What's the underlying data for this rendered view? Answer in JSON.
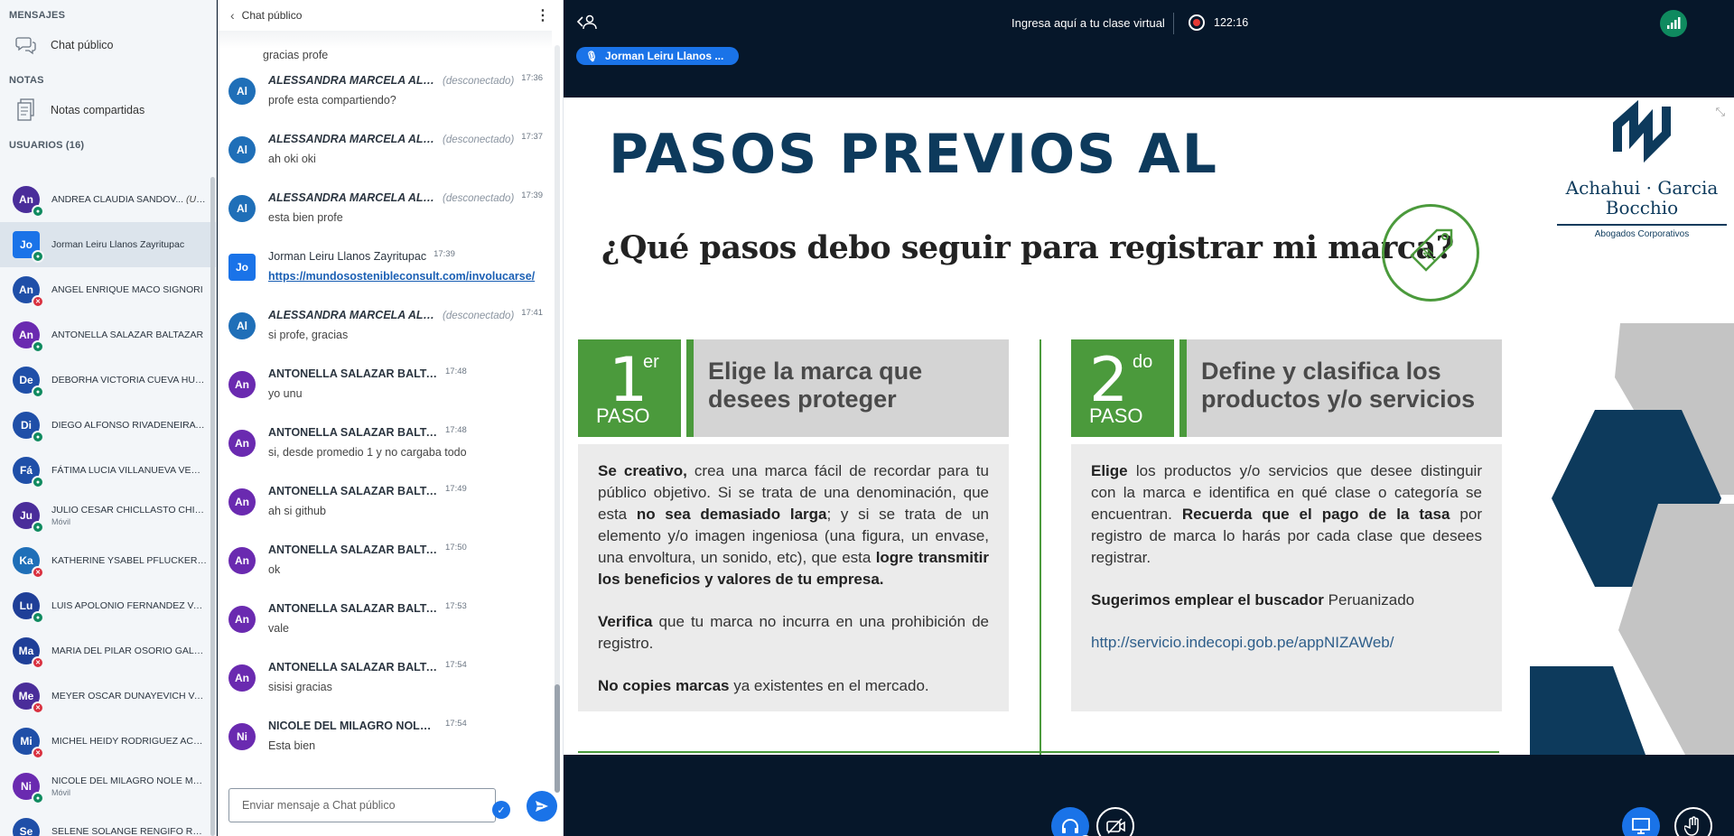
{
  "sidebar": {
    "messages_title": "MENSAJES",
    "public_chat": "Chat público",
    "notes_title": "NOTAS",
    "shared_notes": "Notas compartidas",
    "users_title": "USUARIOS (16)",
    "users": [
      {
        "initials": "An",
        "name": "ANDREA CLAUDIA SANDOV...",
        "you": "(Usted)",
        "sub": "",
        "color": "#4a2d9a",
        "status": "on"
      },
      {
        "initials": "Jo",
        "name": "Jorman Leiru Llanos Zayritupac",
        "sub": "",
        "color": "#1a73e8",
        "status": "on",
        "presenter": true
      },
      {
        "initials": "An",
        "name": "ANGEL ENRIQUE MACO SIGNORI",
        "sub": "",
        "color": "#1f4fa8",
        "status": "off"
      },
      {
        "initials": "An",
        "name": "ANTONELLA SALAZAR BALTAZAR",
        "sub": "",
        "color": "#6a2ab0",
        "status": "on"
      },
      {
        "initials": "De",
        "name": "DEBORHA VICTORIA CUEVA HUAPA...",
        "sub": "",
        "color": "#1f4fa8",
        "status": "on"
      },
      {
        "initials": "Di",
        "name": "DIEGO ALFONSO RIVADENEIRA TU...",
        "sub": "",
        "color": "#1f4fa8",
        "status": "on"
      },
      {
        "initials": "Fá",
        "name": "FÁTIMA LUCIA VILLANUEVA VENEG...",
        "sub": "",
        "color": "#1f4fa8",
        "status": "on"
      },
      {
        "initials": "Ju",
        "name": "JULIO CESAR CHICLLASTO CHIPANA",
        "sub": "Móvil",
        "color": "#4a2d9a",
        "status": "on"
      },
      {
        "initials": "Ka",
        "name": "KATHERINE YSABEL PFLUCKER GU...",
        "sub": "",
        "color": "#1f6fb8",
        "status": "off"
      },
      {
        "initials": "Lu",
        "name": "LUIS APOLONIO FERNANDEZ VARG...",
        "sub": "",
        "color": "#1f3f98",
        "status": "on"
      },
      {
        "initials": "Ma",
        "name": "MARIA DEL PILAR OSORIO GALARZA",
        "sub": "",
        "color": "#1f3f98",
        "status": "off"
      },
      {
        "initials": "Me",
        "name": "MEYER OSCAR DUNAYEVICH VARGAS",
        "sub": "",
        "color": "#4a2d9a",
        "status": "off"
      },
      {
        "initials": "Mi",
        "name": "MICHEL HEIDY RODRIGUEZ ACCOS...",
        "sub": "",
        "color": "#1f4fa8",
        "status": "off"
      },
      {
        "initials": "Ni",
        "name": "NICOLE DEL MILAGRO NOLE MEDINA",
        "sub": "Móvil",
        "color": "#6a2ab0",
        "status": "on"
      },
      {
        "initials": "Se",
        "name": "SELENE SOLANGE RENGIFO RAMIR...",
        "sub": "",
        "color": "#1f4fa8",
        "status": "on"
      }
    ]
  },
  "chat": {
    "title": "Chat público",
    "first_text": "gracias profe",
    "messages": [
      {
        "initials": "Al",
        "name": "ALESSANDRA MARCELA ALEJO...",
        "status": "(desconectado)",
        "time": "17:36",
        "text": "profe esta compartiendo?",
        "color": "#1f6fb8",
        "style": "italic"
      },
      {
        "initials": "Al",
        "name": "ALESSANDRA MARCELA ALEJO...",
        "status": "(desconectado)",
        "time": "17:37",
        "text": "ah oki oki",
        "color": "#1f6fb8",
        "style": "italic"
      },
      {
        "initials": "Al",
        "name": "ALESSANDRA MARCELA ALEJO...",
        "status": "(desconectado)",
        "time": "17:39",
        "text": "esta bien profe",
        "color": "#1f6fb8",
        "style": "italic"
      },
      {
        "initials": "Jo",
        "name": "Jorman Leiru Llanos Zayritupac",
        "status": "",
        "time": "17:39",
        "text": "https://mundosostenibleconsult.com/involucarse/",
        "color": "#1a73e8",
        "style": "plain",
        "link": true
      },
      {
        "initials": "Al",
        "name": "ALESSANDRA MARCELA ALEJO...",
        "status": "(desconectado)",
        "time": "17:41",
        "text": "si profe, gracias",
        "color": "#1f6fb8",
        "style": "italic"
      },
      {
        "initials": "An",
        "name": "ANTONELLA SALAZAR BALTAZAR",
        "status": "",
        "time": "17:48",
        "text": "yo unu",
        "color": "#6a2ab0",
        "style": "bold"
      },
      {
        "initials": "An",
        "name": "ANTONELLA SALAZAR BALTAZAR",
        "status": "",
        "time": "17:48",
        "text": "si, desde promedio 1 y no cargaba todo",
        "color": "#6a2ab0",
        "style": "bold"
      },
      {
        "initials": "An",
        "name": "ANTONELLA SALAZAR BALTAZAR",
        "status": "",
        "time": "17:49",
        "text": "ah si github",
        "color": "#6a2ab0",
        "style": "bold"
      },
      {
        "initials": "An",
        "name": "ANTONELLA SALAZAR BALTAZAR",
        "status": "",
        "time": "17:50",
        "text": "ok",
        "color": "#6a2ab0",
        "style": "bold"
      },
      {
        "initials": "An",
        "name": "ANTONELLA SALAZAR BALTAZAR",
        "status": "",
        "time": "17:53",
        "text": "vale",
        "color": "#6a2ab0",
        "style": "bold"
      },
      {
        "initials": "An",
        "name": "ANTONELLA SALAZAR BALTAZAR",
        "status": "",
        "time": "17:54",
        "text": "sisisi gracias",
        "color": "#6a2ab0",
        "style": "bold"
      },
      {
        "initials": "Ni",
        "name": "NICOLE DEL MILAGRO NOLE MEDINA",
        "status": "",
        "time": "17:54",
        "text": "Esta bien",
        "color": "#6a2ab0",
        "style": "bold"
      }
    ],
    "input_placeholder": "Enviar mensaje a Chat público"
  },
  "meeting": {
    "title": "Ingresa aquí a tu clase virtual",
    "timer": "122:16",
    "talker": "Jorman Leiru Llanos ...",
    "connection_icon": "signal-bars-icon"
  },
  "slide": {
    "title": "PASOS PREVIOS AL",
    "subtitle": "¿Qué pasos debo seguir para registrar mi marca?",
    "logo_name": "Achahui · Garcia Bocchio",
    "logo_sub": "Abogados Corporativos",
    "step1": {
      "num": "1",
      "sup": "er",
      "paso": "PASO",
      "title": "Elige la marca que desees proteger",
      "p1_b1": "Se creativo,",
      "p1_t1": " crea una marca fácil de recordar para tu público objetivo. Si se trata de una denominación, que esta ",
      "p1_b2": "no sea demasiado larga",
      "p1_t2": "; y si se trata de un elemento y/o imagen ingeniosa (una figura, un envase, una envoltura, un sonido, etc), que esta ",
      "p1_b3": "logre transmitir los beneficios y valores de tu empresa.",
      "p2_b": "Verifica",
      "p2_t": " que tu marca no incurra en una prohibición de registro.",
      "p3_b": "No copies marcas",
      "p3_t": " ya existentes en el mercado."
    },
    "step2": {
      "num": "2",
      "sup": "do",
      "paso": "PASO",
      "title": "Define y clasifica los productos y/o servicios",
      "p1_b1": "Elige",
      "p1_t1": " los productos y/o servicios que desee distinguir con la marca e identifica en qué clase o categoría se encuentran. ",
      "p1_b2": "Recuerda que el pago de la tasa",
      "p1_t2": " por registro de marca lo harás por cada clase que desees registrar.",
      "p2_b": "Sugerimos emplear el buscador",
      "p2_t": " Peruanizado",
      "link": "http://servicio.indecopi.gob.pe/appNIZAWeb/"
    }
  },
  "colors": {
    "brand_navy": "#0d3a5c",
    "slide_green": "#4b9a3c",
    "accent_blue": "#1a73e8",
    "stage_bg": "#06172a"
  }
}
